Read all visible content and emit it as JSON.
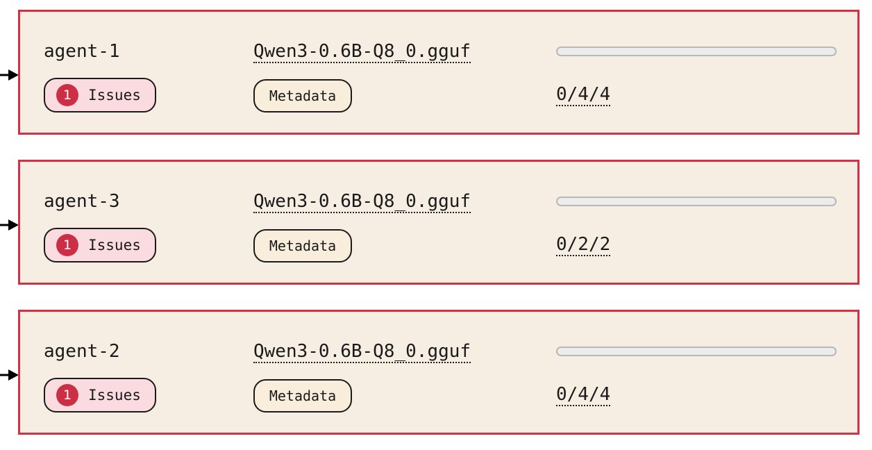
{
  "colors": {
    "card_background": "#f6ede3",
    "card_border": "#cc3344",
    "issues_background": "#fadbe0",
    "issue_badge": "#cc2f45",
    "metadata_background": "#f9eedc",
    "progress_track": "#ececec"
  },
  "icons": {
    "row_pointer": "arrow-right-icon"
  },
  "agents": [
    {
      "name": "agent-1",
      "model": "Qwen3-0.6B-Q8_0.gguf",
      "progress": 0,
      "issues_count": "1",
      "issues_label": "Issues",
      "metadata_label": "Metadata",
      "counts": "0/4/4"
    },
    {
      "name": "agent-3",
      "model": "Qwen3-0.6B-Q8_0.gguf",
      "progress": 0,
      "issues_count": "1",
      "issues_label": "Issues",
      "metadata_label": "Metadata",
      "counts": "0/2/2"
    },
    {
      "name": "agent-2",
      "model": "Qwen3-0.6B-Q8_0.gguf",
      "progress": 0,
      "issues_count": "1",
      "issues_label": "Issues",
      "metadata_label": "Metadata",
      "counts": "0/4/4"
    }
  ]
}
